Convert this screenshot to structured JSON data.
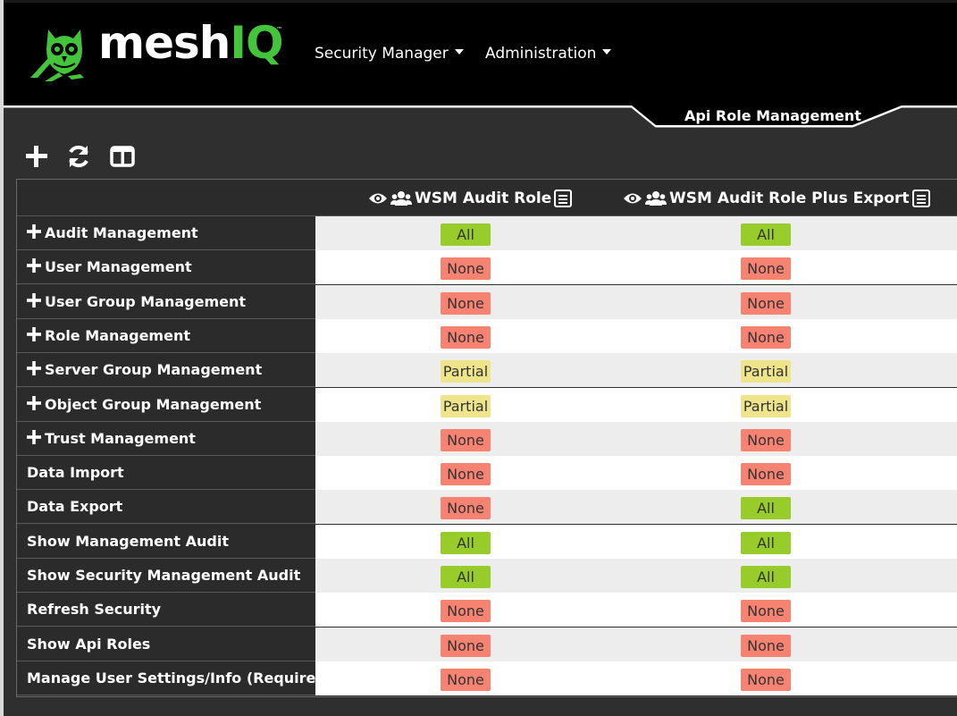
{
  "brand": {
    "name_part1": "mesh",
    "name_part2": "IQ",
    "tm": "™"
  },
  "nav": [
    {
      "label": "Security Manager"
    },
    {
      "label": "Administration"
    }
  ],
  "page_tab": {
    "label": "Api Role Management"
  },
  "toolbar": {
    "icons": [
      "plus-icon",
      "refresh-icon",
      "columns-icon"
    ]
  },
  "roles": [
    {
      "name": "WSM Audit Role"
    },
    {
      "name": "WSM Audit Role Plus Export"
    }
  ],
  "permission_colors": {
    "All": "#97cc2b",
    "None": "#f68272",
    "Partial": "#eee48b"
  },
  "rows": [
    {
      "label": "Audit Management",
      "expandable": true,
      "values": [
        "All",
        "All"
      ]
    },
    {
      "label": "User Management",
      "expandable": true,
      "values": [
        "None",
        "None"
      ]
    },
    {
      "label": "User Group Management",
      "expandable": true,
      "values": [
        "None",
        "None"
      ]
    },
    {
      "label": "Role Management",
      "expandable": true,
      "values": [
        "None",
        "None"
      ]
    },
    {
      "label": "Server Group Management",
      "expandable": true,
      "values": [
        "Partial",
        "Partial"
      ]
    },
    {
      "label": "Object Group Management",
      "expandable": true,
      "values": [
        "Partial",
        "Partial"
      ]
    },
    {
      "label": "Trust Management",
      "expandable": true,
      "values": [
        "None",
        "None"
      ]
    },
    {
      "label": "Data Import",
      "expandable": false,
      "values": [
        "None",
        "None"
      ]
    },
    {
      "label": "Data Export",
      "expandable": false,
      "values": [
        "None",
        "All"
      ]
    },
    {
      "label": "Show Management Audit",
      "expandable": false,
      "values": [
        "All",
        "All"
      ]
    },
    {
      "label": "Show Security Management Audit",
      "expandable": false,
      "values": [
        "All",
        "All"
      ]
    },
    {
      "label": "Refresh Security",
      "expandable": false,
      "values": [
        "None",
        "None"
      ]
    },
    {
      "label": "Show Api Roles",
      "expandable": false,
      "values": [
        "None",
        "None"
      ]
    },
    {
      "label": "Manage User Settings/Info (Required)",
      "expandable": false,
      "values": [
        "None",
        "None"
      ]
    }
  ]
}
